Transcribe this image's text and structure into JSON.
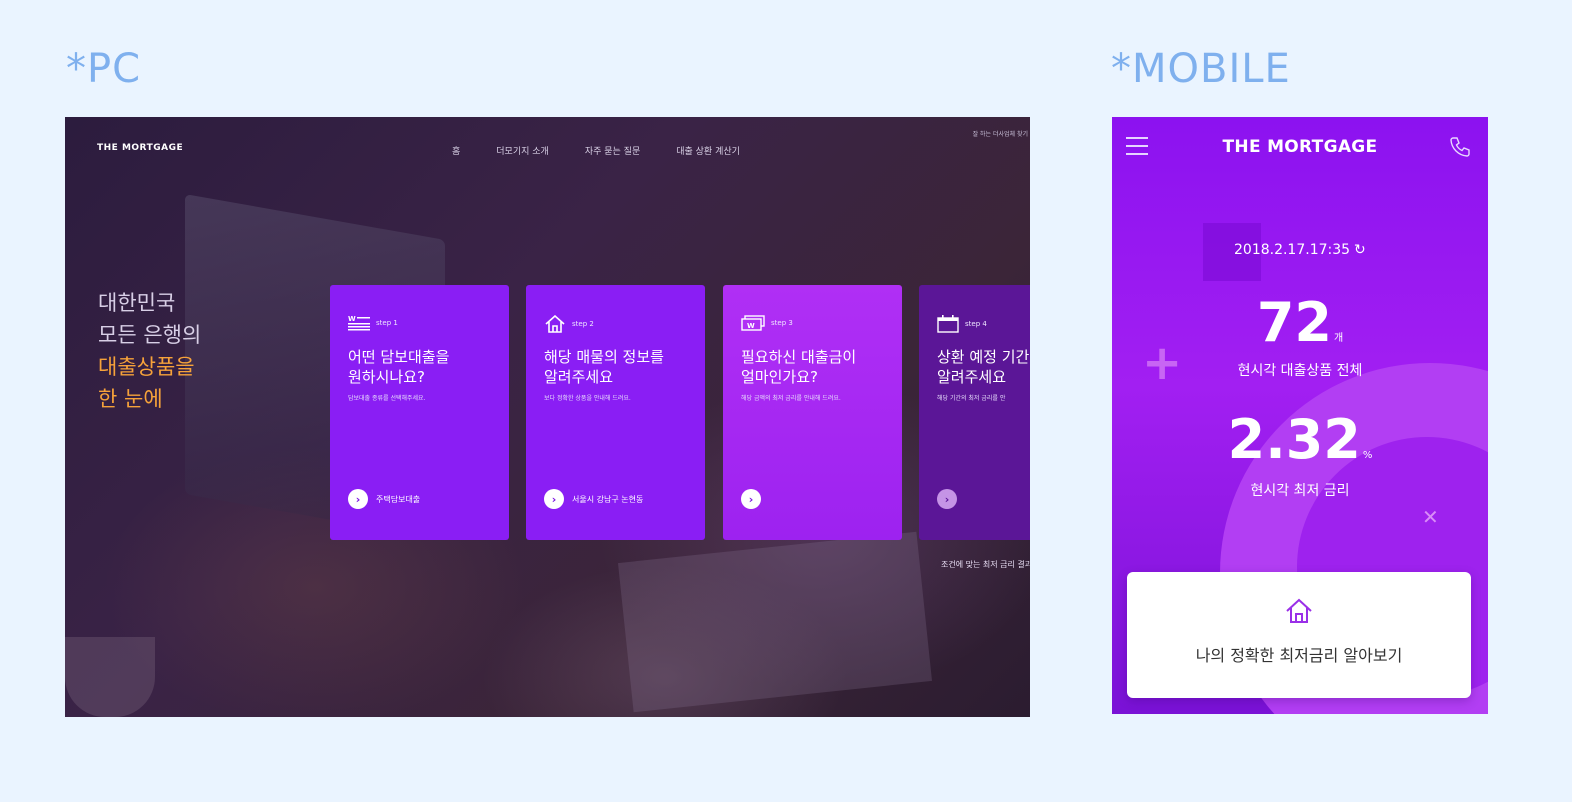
{
  "labels": {
    "pc": "*PC",
    "mobile": "*MOBILE"
  },
  "colors": {
    "purple": "#8a1ef4",
    "accent_orange": "#f6a23a",
    "label_blue": "#7fb0ee"
  },
  "pc": {
    "logo": "THE MORTGAGE",
    "nav": [
      "홈",
      "더모기지 소개",
      "자주 묻는 질문",
      "대출 상환 계산기"
    ],
    "top_right": "잘 하는 더사업체 찾기",
    "hero": {
      "line1": "대한민국",
      "line2": "모든 은행의",
      "line3": "대출상품을",
      "line4": "한 눈에"
    },
    "cards": [
      {
        "icon": "list-icon",
        "step": "step 1",
        "title1": "어떤 담보대출을",
        "title2": "원하시나요?",
        "desc": "담보대출 종류를 선택해주세요.",
        "cta": "주택담보대출"
      },
      {
        "icon": "house-icon",
        "step": "step 2",
        "title1": "해당 매물의 정보를",
        "title2": "알려주세요",
        "desc": "보다 정확한 상품을 안내해 드려요.",
        "cta": "서울시 강남구 논현동"
      },
      {
        "icon": "money-icon",
        "step": "step 3",
        "title1": "필요하신 대출금이",
        "title2": "얼마인가요?",
        "desc": "해당 금액의 최저 금리를 안내해 드려요.",
        "cta": ""
      },
      {
        "icon": "calendar-icon",
        "step": "step 4",
        "title1": "상환 예정 기간",
        "title2": "알려주세요",
        "desc": "해당 기간의 최저 금리를 안",
        "cta": ""
      }
    ],
    "bottom_note": "조건에 맞는 최저 금리 결과"
  },
  "mobile": {
    "logo": "THE MORTGAGE",
    "datetime": "2018.2.17.17:35",
    "product_count": "72",
    "product_unit": "개",
    "product_label": "현시각 대출상품 전체",
    "rate": "2.32",
    "rate_unit": "%",
    "rate_label": "현시각 최저 금리",
    "cta_label": "나의 정확한 최저금리 알아보기"
  }
}
